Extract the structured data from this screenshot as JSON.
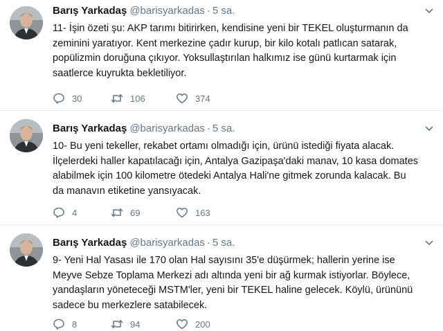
{
  "colors": {
    "text": "#14171a",
    "secondary": "#657786",
    "divider": "#e6ecf0"
  },
  "tweets": [
    {
      "author": "Barış Yarkadaş",
      "handle": "@barisyarkadas",
      "separator": "·",
      "time": "5 sa.",
      "text": "11- İşin özeti şu: AKP tarımı bitirirken, kendisine yeni bir TEKEL oluşturmanın da\nzeminini yaratıyor. Kent merkezine çadır kurup, bir kilo kotalı patlıcan satarak,\npopülizmin doruğuna çıkıyor. Yoksullaştırılan halkımız ise günü kurtarmak için\nsaatlerce kuyrukta bekletiliyor.",
      "replies": "30",
      "retweets": "106",
      "likes": "374"
    },
    {
      "author": "Barış Yarkadaş",
      "handle": "@barisyarkadas",
      "separator": "·",
      "time": "5 sa.",
      "text": "10- Bu yeni tekeller, rekabet ortamı olmadığı için, ürünü istediği fiyata alacak.\nİlçelerdeki haller kapatılacağı için, Antalya Gazipaşa'daki manav, 10 kasa domates\nalabilmek için 100 kilometre ötedeki Antalya Hali'ne gitmek zorunda kalacak. Bu\nda manavın etiketine yansıyacak.",
      "replies": "4",
      "retweets": "69",
      "likes": "163"
    },
    {
      "author": "Barış Yarkadaş",
      "handle": "@barisyarkadas",
      "separator": "·",
      "time": "5 sa.",
      "text": "9- Yeni Hal Yasası ile 170 olan Hal sayısını 35'e düşürmek; hallerin yerine ise\nMeyve Sebze Toplama Merkezi adı altında yeni bir ağ kurmak istiyorlar. Böylece,\nyandaşların yöneteceği MSTM'ler, yeni bir TEKEL haline gelecek. Köylü, ürününü\nsadece bu merkezlere satabilecek.",
      "replies": "8",
      "retweets": "94",
      "likes": "200"
    }
  ]
}
